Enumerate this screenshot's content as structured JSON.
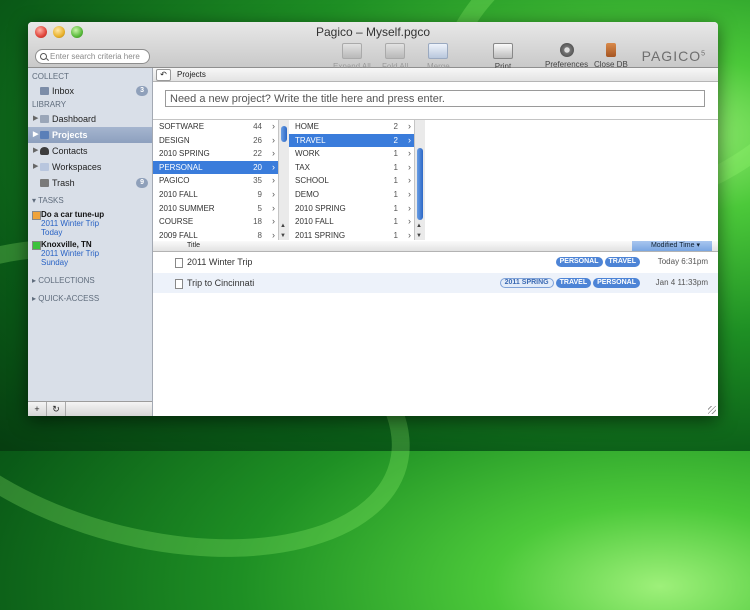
{
  "window": {
    "title": "Pagico – Myself.pgco"
  },
  "search": {
    "placeholder": "Enter search criteria here"
  },
  "toolbar": {
    "expand_all": "Expand All",
    "fold_all": "Fold All",
    "merge": "Merge",
    "print": "Print",
    "preferences": "Preferences",
    "close_db": "Close DB"
  },
  "logo": {
    "text": "PAGICO",
    "version": "5"
  },
  "sidebar": {
    "collect_header": "COLLECT",
    "inbox": {
      "label": "Inbox",
      "count": "3"
    },
    "library_header": "LIBRARY",
    "items": [
      {
        "label": "Dashboard"
      },
      {
        "label": "Projects"
      },
      {
        "label": "Contacts"
      },
      {
        "label": "Workspaces"
      },
      {
        "label": "Trash",
        "count": "9"
      }
    ],
    "tasks_header": "TASKS",
    "tasks": [
      {
        "title": "Do a car tune-up",
        "project": "2011 Winter Trip",
        "when": "Today",
        "color": "#f0a33a"
      },
      {
        "title": "Knoxville, TN",
        "project": "2011 Winter Trip",
        "when": "Sunday",
        "color": "#3cc23c"
      }
    ],
    "collections_header": "COLLECTIONS",
    "quick_access_header": "QUICK-ACCESS"
  },
  "main": {
    "breadcrumb": "Projects",
    "new_project_prompt": "Need a new project? Write the title here and press enter.",
    "tags_col": [
      {
        "label": "SOFTWARE",
        "count": "44"
      },
      {
        "label": "DESIGN",
        "count": "26"
      },
      {
        "label": "2010 SPRING",
        "count": "22"
      },
      {
        "label": "PERSONAL",
        "count": "20",
        "selected": true
      },
      {
        "label": "PAGICO",
        "count": "35"
      },
      {
        "label": "2010 FALL",
        "count": "9"
      },
      {
        "label": "2010 SUMMER",
        "count": "5"
      },
      {
        "label": "COURSE",
        "count": "18"
      },
      {
        "label": "2009 FALL",
        "count": "8"
      }
    ],
    "subtags_col": [
      {
        "label": "HOME",
        "count": "2"
      },
      {
        "label": "TRAVEL",
        "count": "2",
        "selected": true
      },
      {
        "label": "WORK",
        "count": "1"
      },
      {
        "label": "TAX",
        "count": "1"
      },
      {
        "label": "SCHOOL",
        "count": "1"
      },
      {
        "label": "DEMO",
        "count": "1"
      },
      {
        "label": "2010 SPRING",
        "count": "1"
      },
      {
        "label": "2010 FALL",
        "count": "1"
      },
      {
        "label": "2011 SPRING",
        "count": "1"
      }
    ],
    "table": {
      "col_title": "Title",
      "col_modified": "Modified Time",
      "rows": [
        {
          "title": "2011 Winter Trip",
          "tags": [
            "PERSONAL",
            "TRAVEL"
          ],
          "outline_tags": [],
          "modified": "Today 6:31pm"
        },
        {
          "title": "Trip to Cincinnati",
          "tags": [
            "TRAVEL",
            "PERSONAL"
          ],
          "outline_tags": [
            "2011 SPRING"
          ],
          "modified": "Jan 4 11:33pm"
        }
      ]
    }
  },
  "bottom": {
    "add": "+",
    "sync": "↻"
  }
}
